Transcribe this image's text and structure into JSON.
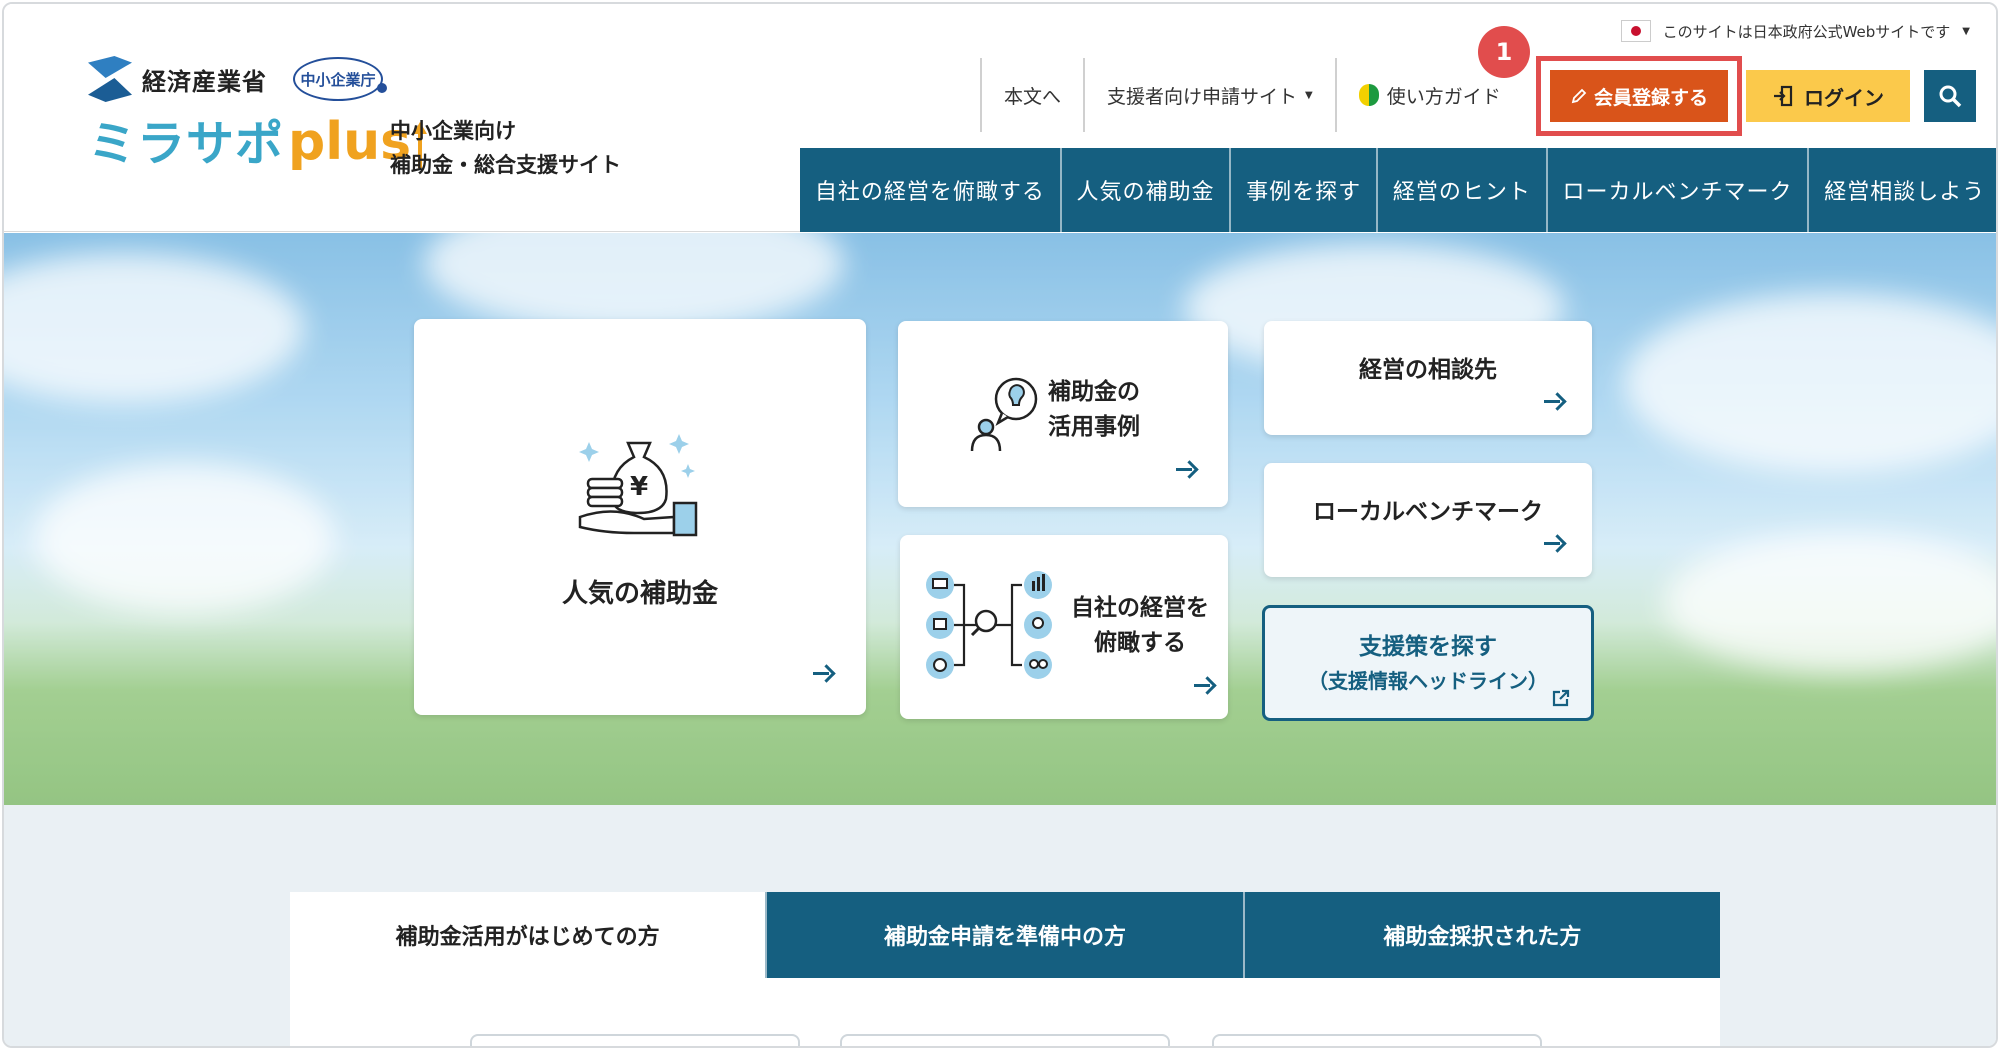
{
  "header": {
    "gov_notice": "このサイトは日本政府公式Webサイトです",
    "meti_name": "経済産業省",
    "sme_agency": "中小企業庁",
    "brand_katakana": "ミラサポ",
    "brand_plus": "plus",
    "tagline_line1": "中小企業向け",
    "tagline_line2": "補助金・総合支援サイト",
    "util_nav": {
      "skip": "本文へ",
      "supporter": "支援者向け申請サイト",
      "guide": "使い方ガイド"
    },
    "register_label": "会員登録する",
    "login_label": "ログイン",
    "step_number": "1"
  },
  "main_nav": [
    "自社の経営を俯瞰する",
    "人気の補助金",
    "事例を探す",
    "経営のヒント",
    "ローカルベンチマーク",
    "経営相談しよう"
  ],
  "hero_cards": {
    "popular_subsidy": "人気の補助金",
    "case_line1": "補助金の",
    "case_line2": "活用事例",
    "overview_line1": "自社の経営を",
    "overview_line2": "俯瞰する",
    "consult": "経営の相談先",
    "benchmark": "ローカルベンチマーク",
    "support_line1": "支援策を探す",
    "support_line2": "（支援情報ヘッドライン）"
  },
  "tabs": [
    "補助金活用がはじめての方",
    "補助金申請を準備中の方",
    "補助金採択された方"
  ],
  "colors": {
    "nav_blue": "#155f80",
    "register_orange": "#d9541a",
    "login_yellow": "#fbc94b",
    "highlight_red": "#e14d4d"
  }
}
